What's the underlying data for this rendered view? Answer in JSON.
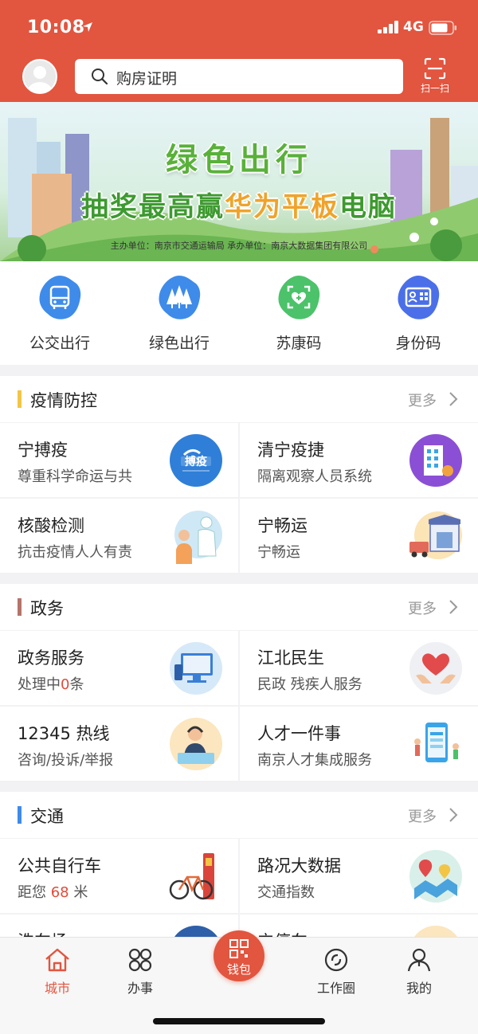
{
  "status": {
    "time": "10:08",
    "network": "4G"
  },
  "header": {
    "search_placeholder": "购房证明",
    "scan_label": "扫一扫"
  },
  "banner": {
    "title": "绿色出行",
    "line2_a": "抽奖最高赢",
    "line2_b": "华为平板",
    "line2_c": "电脑",
    "sponsor": "主办单位：南京市交通运输局 承办单位：南京大数据集团有限公司"
  },
  "quick_links": [
    {
      "label": "公交出行",
      "icon": "bus-icon",
      "color": "#3e8bea"
    },
    {
      "label": "绿色出行",
      "icon": "trees-icon",
      "color": "#3e8bea"
    },
    {
      "label": "苏康码",
      "icon": "health-code-icon",
      "color": "#4cc26a"
    },
    {
      "label": "身份码",
      "icon": "id-code-icon",
      "color": "#4a6fe8"
    }
  ],
  "sections": {
    "epidemic": {
      "title": "疫情防控",
      "more": "更多",
      "bar_color": "#f3c545",
      "cards": [
        {
          "title": "宁搏疫",
          "subtitle": "尊重科学命运与共",
          "icon": "ningboyi-logo-icon"
        },
        {
          "title": "清宁疫捷",
          "subtitle": "隔离观察人员系统",
          "icon": "building-icon"
        },
        {
          "title": "核酸检测",
          "subtitle": "抗击疫情人人有责",
          "icon": "nucleic-test-icon"
        },
        {
          "title": "宁畅运",
          "subtitle": "宁畅运",
          "icon": "cold-chain-truck-icon"
        }
      ]
    },
    "gov": {
      "title": "政务",
      "more": "更多",
      "bar_color": "#b5746a",
      "cards": [
        {
          "title": "政务服务",
          "subtitle_pre": "处理中",
          "subtitle_num": "0",
          "subtitle_post": "条",
          "icon": "computer-icon"
        },
        {
          "title": "江北民生",
          "subtitle": "民政  残疾人服务",
          "icon": "heart-hands-icon"
        },
        {
          "title": "12345 热线",
          "subtitle": "咨询/投诉/举报",
          "icon": "hotline-agent-icon"
        },
        {
          "title": "人才一件事",
          "subtitle": "南京人才集成服务",
          "icon": "talent-phone-icon"
        }
      ]
    },
    "traffic": {
      "title": "交通",
      "more": "更多",
      "bar_color": "#3e8bea",
      "cards": [
        {
          "title": "公共自行车",
          "subtitle_pre": "距您 ",
          "subtitle_num": "68",
          "subtitle_post": " 米",
          "icon": "bicycle-icon"
        },
        {
          "title": "路况大数据",
          "subtitle": "交通指数",
          "icon": "map-pins-icon"
        },
        {
          "title": "洗车场",
          "subtitle": "",
          "icon": "car-wash-icon"
        },
        {
          "title": "宁停车",
          "subtitle": "",
          "icon": "parking-icon"
        }
      ]
    }
  },
  "nav": {
    "city": "城市",
    "affairs": "办事",
    "wallet": "钱包",
    "circle": "工作圈",
    "mine": "我的",
    "accent": "#e2553f"
  }
}
